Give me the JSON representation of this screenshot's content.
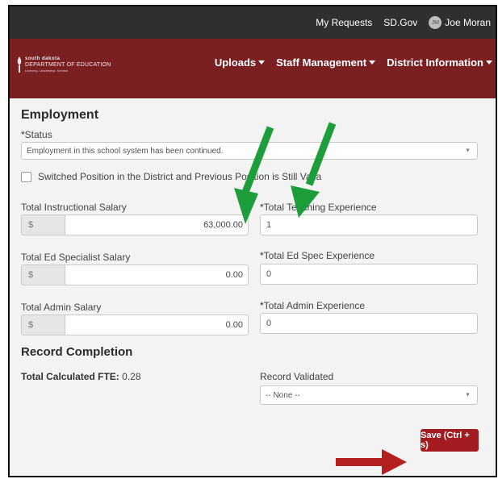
{
  "topbar": {
    "links": [
      "My Requests",
      "SD.Gov"
    ],
    "user_initials": "JM",
    "user_name": "Joe Moran"
  },
  "logo": {
    "line1": "south dakota",
    "line2": "DEPARTMENT OF EDUCATION",
    "line3": "Learning. Leadership. Service."
  },
  "nav": {
    "uploads": "Uploads",
    "staff": "Staff Management",
    "district": "District Information"
  },
  "employment": {
    "title": "Employment",
    "status_label": "Status",
    "status_value": "Employment in this school system has been continued.",
    "switched_label": "Switched Position in the District and Previous Position is Still Vaca",
    "instr_salary_label": "Total Instructional Salary",
    "instr_salary_prefix": "$",
    "instr_salary_value": "63,000.00",
    "teach_exp_label": "Total Teaching Experience",
    "teach_exp_value": "1",
    "edspec_salary_label": "Total Ed Specialist Salary",
    "edspec_salary_prefix": "$",
    "edspec_salary_value": "0.00",
    "edspec_exp_label": "Total Ed Spec Experience",
    "edspec_exp_value": "0",
    "admin_salary_label": "Total Admin Salary",
    "admin_salary_prefix": "$",
    "admin_salary_value": "0.00",
    "admin_exp_label": "Total Admin Experience",
    "admin_exp_value": "0"
  },
  "record": {
    "title": "Record Completion",
    "fte_label": "Total Calculated FTE:",
    "fte_value": "0.28",
    "validated_label": "Record Validated",
    "validated_value": "-- None --"
  },
  "actions": {
    "save_label": "Save (Ctrl + s)"
  },
  "colors": {
    "header": "#7a1f22",
    "topbar": "#2f2f2f",
    "save_button": "#a21c22",
    "green_arrow": "#1e9e3a",
    "red_arrow": "#b3201e"
  }
}
